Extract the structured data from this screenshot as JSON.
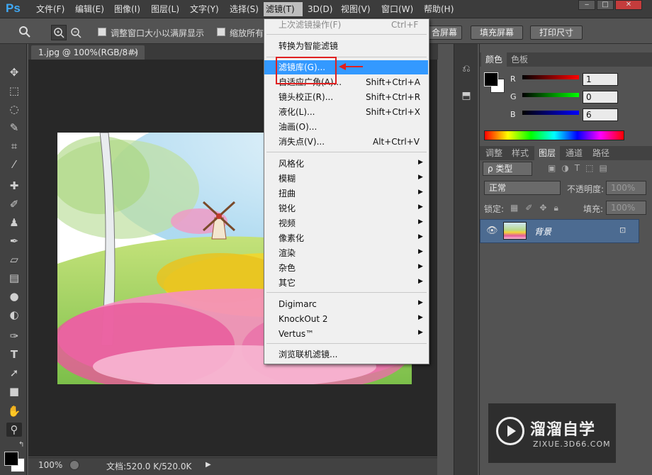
{
  "menubar": {
    "logo": "Ps",
    "items": [
      "文件(F)",
      "编辑(E)",
      "图像(I)",
      "图层(L)",
      "文字(Y)",
      "选择(S)",
      "滤镜(T)",
      "3D(D)",
      "视图(V)",
      "窗口(W)",
      "帮助(H)"
    ],
    "window_buttons": [
      "‒",
      "□",
      "✕"
    ]
  },
  "options": {
    "resize_windows": "调整窗口大小以满屏显示",
    "zoom_all": "缩放所有",
    "fit_screen": "合屏幕",
    "fill_screen": "填充屏幕",
    "print_size": "打印尺寸"
  },
  "document": {
    "tab_title": "1.jpg @ 100%(RGB/8#)",
    "tab_close": "×",
    "zoom": "100%",
    "doc_size": "文档:520.0 K/520.0K"
  },
  "filter_menu": {
    "items": [
      {
        "label": "上次滤镜操作(F)",
        "shortcut": "Ctrl+F",
        "disabled": true
      },
      {
        "label": "转换为智能滤镜"
      },
      {
        "label": "滤镜库(G)...",
        "highlighted": true
      },
      {
        "label": "自适应广角(A)...",
        "shortcut": "Shift+Ctrl+A"
      },
      {
        "label": "镜头校正(R)...",
        "shortcut": "Shift+Ctrl+R"
      },
      {
        "label": "液化(L)...",
        "shortcut": "Shift+Ctrl+X"
      },
      {
        "label": "油画(O)..."
      },
      {
        "label": "消失点(V)...",
        "shortcut": "Alt+Ctrl+V"
      },
      {
        "label": "风格化",
        "submenu": true
      },
      {
        "label": "模糊",
        "submenu": true
      },
      {
        "label": "扭曲",
        "submenu": true
      },
      {
        "label": "锐化",
        "submenu": true
      },
      {
        "label": "视频",
        "submenu": true
      },
      {
        "label": "像素化",
        "submenu": true
      },
      {
        "label": "渲染",
        "submenu": true
      },
      {
        "label": "杂色",
        "submenu": true
      },
      {
        "label": "其它",
        "submenu": true
      },
      {
        "label": "Digimarc",
        "submenu": true
      },
      {
        "label": "KnockOut 2",
        "submenu": true
      },
      {
        "label": "Vertus™",
        "submenu": true
      },
      {
        "label": "浏览联机滤镜..."
      }
    ]
  },
  "color_panel": {
    "tabs": [
      "颜色",
      "色板"
    ],
    "r_label": "R",
    "g_label": "G",
    "b_label": "B",
    "r_value": "1",
    "g_value": "0",
    "b_value": "6"
  },
  "layers_panel": {
    "tabs": [
      "调整",
      "样式",
      "图层",
      "通道",
      "路径"
    ],
    "kind_filter": "ρ 类型",
    "blend_mode": "正常",
    "opacity_label": "不透明度:",
    "opacity_value": "100%",
    "lock_label": "锁定:",
    "fill_label": "填充:",
    "fill_value": "100%",
    "layer_name": "背景"
  },
  "watermark": {
    "title": "溜溜自学",
    "url": "ZIXUE.3D66.COM"
  },
  "colors": {
    "highlight": "#3399ff",
    "annotation_red": "#e02020",
    "layer_selected": "#4c6b91"
  }
}
